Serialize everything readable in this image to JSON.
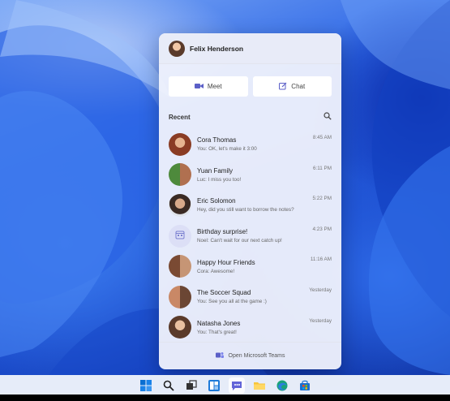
{
  "user": {
    "name": "Felix Henderson"
  },
  "actions": {
    "meet_label": "Meet",
    "chat_label": "Chat"
  },
  "recent": {
    "label": "Recent"
  },
  "chats": [
    {
      "name": "Cora Thomas",
      "preview": "You: OK, let's make it 3:00",
      "time": "8:45 AM",
      "avatar": "person-photo"
    },
    {
      "name": "Yuan Family",
      "preview": "Luc: I miss you too!",
      "time": "6:11 PM",
      "avatar": "group-photo"
    },
    {
      "name": "Eric Solomon",
      "preview": "Hey, did you still want to borrow the notes?",
      "time": "5:22 PM",
      "avatar": "person-photo"
    },
    {
      "name": "Birthday surprise!",
      "preview": "Noel: Can't wait for our next catch up!",
      "time": "4:23 PM",
      "avatar": "calendar-icon"
    },
    {
      "name": "Happy Hour Friends",
      "preview": "Cora: Awesome!",
      "time": "11:16 AM",
      "avatar": "group-photo"
    },
    {
      "name": "The Soccer Squad",
      "preview": "You: See you all at the game :)",
      "time": "Yesterday",
      "avatar": "group-photo"
    },
    {
      "name": "Natasha Jones",
      "preview": "You: That's great!",
      "time": "Yesterday",
      "avatar": "person-photo"
    }
  ],
  "footer": {
    "label": "Open Microsoft Teams"
  },
  "taskbar": {
    "icons": [
      "windows-start-icon",
      "search-icon",
      "task-view-icon",
      "widgets-icon",
      "teams-chat-icon",
      "file-explorer-icon",
      "edge-icon",
      "store-icon"
    ]
  },
  "colors": {
    "accent": "#5b5fc7",
    "wallpaper": "#1d52d6"
  }
}
